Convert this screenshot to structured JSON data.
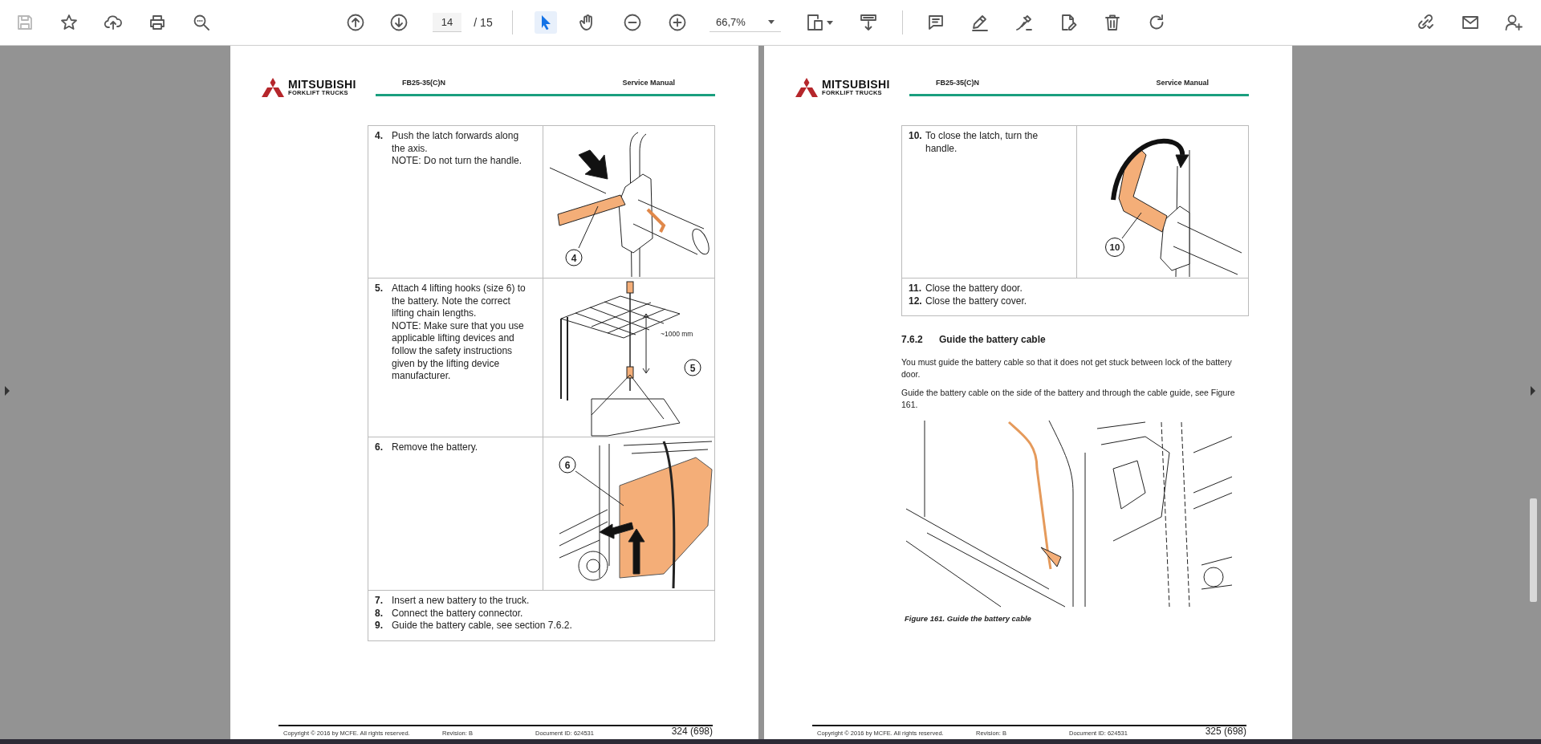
{
  "toolbar": {
    "save": {
      "disabled": true
    },
    "page_number": "14",
    "page_total": "/ 15",
    "select_tool": {
      "selected": true
    },
    "hand_tool": {
      "selected": false
    },
    "zoom": "66,7%"
  },
  "pages": [
    {
      "logo": {
        "brand": "MITSUBISHI",
        "subtitle": "FORKLIFT TRUCKS"
      },
      "model": "FB25-35(C)N",
      "document_title": "Service Manual",
      "blocks": [
        {
          "kind": "step_table",
          "rows": [
            {
              "steps": [
                {
                  "number": "4.",
                  "lines": [
                    "Push the latch forwards along the axis.",
                    "NOTE: Do not turn the handle."
                  ]
                }
              ],
              "figure": {
                "kind": "latch_push",
                "callouts": [
                  {
                    "kind": "circle",
                    "text": "4"
                  }
                ]
              }
            },
            {
              "steps": [
                {
                  "number": "5.",
                  "lines": [
                    "Attach 4 lifting hooks (size 6) to the battery. Note the correct lifting chain lengths.",
                    "NOTE: Make sure that you use applicable lifting devices and follow the safety instructions given by the lifting device manufacturer."
                  ]
                }
              ],
              "figure": {
                "kind": "battery_lift",
                "callouts": [
                  {
                    "kind": "dimension",
                    "text": "~1000 mm"
                  },
                  {
                    "kind": "circle",
                    "text": "5"
                  }
                ]
              }
            },
            {
              "steps": [
                {
                  "number": "6.",
                  "lines": [
                    "Remove the battery."
                  ]
                }
              ],
              "figure": {
                "kind": "battery_remove",
                "callouts": [
                  {
                    "kind": "circle",
                    "text": "6"
                  }
                ]
              }
            },
            {
              "steps": [
                {
                  "number": "7.",
                  "lines": [
                    "Insert a new battery to the truck."
                  ]
                },
                {
                  "number": "8.",
                  "lines": [
                    "Connect the battery connector."
                  ]
                },
                {
                  "number": "9.",
                  "lines": [
                    "Guide the battery cable, see section 7.6.2."
                  ]
                }
              ]
            }
          ]
        }
      ],
      "footer": {
        "copyright": "Copyright © 2016 by MCFE. All rights reserved.",
        "revision": "Revision: B",
        "document_id": "Document ID: 624531",
        "page": "324 (698)"
      }
    },
    {
      "logo": {
        "brand": "MITSUBISHI",
        "subtitle": "FORKLIFT TRUCKS"
      },
      "model": "FB25-35(C)N",
      "document_title": "Service Manual",
      "blocks": [
        {
          "kind": "step_table",
          "rows": [
            {
              "steps": [
                {
                  "number": "10.",
                  "lines": [
                    "To close the latch, turn the handle."
                  ]
                }
              ],
              "figure": {
                "kind": "handle_close",
                "callouts": [
                  {
                    "kind": "circle",
                    "text": "10"
                  }
                ]
              }
            },
            {
              "steps": [
                {
                  "number": "11.",
                  "lines": [
                    "Close the battery door."
                  ]
                },
                {
                  "number": "12.",
                  "lines": [
                    "Close the battery cover."
                  ]
                }
              ]
            }
          ]
        },
        {
          "kind": "heading",
          "number": "7.6.2",
          "title": "Guide the battery cable"
        },
        {
          "kind": "paragraph",
          "text": "You must guide the battery cable so that it does not get stuck between lock of the battery door."
        },
        {
          "kind": "paragraph",
          "text": "Guide the battery cable on the side of the battery and through the cable guide, see Figure 161."
        },
        {
          "kind": "figure",
          "drawing": {
            "kind": "battery_cable"
          },
          "caption": "Figure 161. Guide the battery cable"
        }
      ],
      "footer": {
        "copyright": "Copyright © 2016 by MCFE. All rights reserved.",
        "revision": "Revision: B",
        "document_id": "Document ID: 624531",
        "page": "325 (698)"
      }
    }
  ]
}
